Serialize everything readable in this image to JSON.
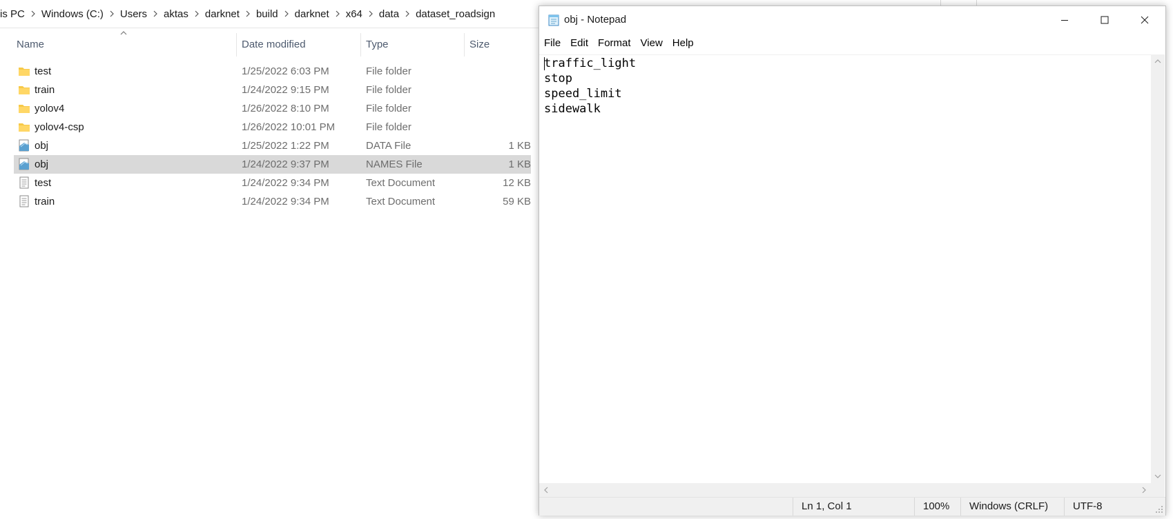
{
  "explorer": {
    "breadcrumb": [
      "is PC",
      "Windows (C:)",
      "Users",
      "aktas",
      "darknet",
      "build",
      "darknet",
      "x64",
      "data",
      "dataset_roadsign"
    ],
    "columns": {
      "name": "Name",
      "date": "Date modified",
      "type": "Type",
      "size": "Size"
    },
    "files": [
      {
        "name": "test",
        "date": "1/25/2022 6:03 PM",
        "type": "File folder",
        "size": "",
        "icon": "folder-icon",
        "selected": false
      },
      {
        "name": "train",
        "date": "1/24/2022 9:15 PM",
        "type": "File folder",
        "size": "",
        "icon": "folder-icon",
        "selected": false
      },
      {
        "name": "yolov4",
        "date": "1/26/2022 8:10 PM",
        "type": "File folder",
        "size": "",
        "icon": "folder-icon",
        "selected": false
      },
      {
        "name": "yolov4-csp",
        "date": "1/26/2022 10:01 PM",
        "type": "File folder",
        "size": "",
        "icon": "folder-icon",
        "selected": false
      },
      {
        "name": "obj",
        "date": "1/25/2022 1:22 PM",
        "type": "DATA File",
        "size": "1 KB",
        "icon": "data-file-icon",
        "selected": false
      },
      {
        "name": "obj",
        "date": "1/24/2022 9:37 PM",
        "type": "NAMES File",
        "size": "1 KB",
        "icon": "data-file-icon",
        "selected": true
      },
      {
        "name": "test",
        "date": "1/24/2022 9:34 PM",
        "type": "Text Document",
        "size": "12 KB",
        "icon": "text-document-icon",
        "selected": false
      },
      {
        "name": "train",
        "date": "1/24/2022 9:34 PM",
        "type": "Text Document",
        "size": "59 KB",
        "icon": "text-document-icon",
        "selected": false
      }
    ]
  },
  "notepad": {
    "title": "obj - Notepad",
    "menu": [
      "File",
      "Edit",
      "Format",
      "View",
      "Help"
    ],
    "content": "traffic_light\nstop\nspeed_limit\nsidewalk",
    "status": {
      "position": "Ln 1, Col 1",
      "zoom": "100%",
      "line_endings": "Windows (CRLF)",
      "encoding": "UTF-8"
    }
  },
  "colors": {
    "selected_row": "#d9d9d9",
    "folder": "#f7c948",
    "header_text": "#4d5a6e",
    "status_bar": "#f0f0f0"
  }
}
